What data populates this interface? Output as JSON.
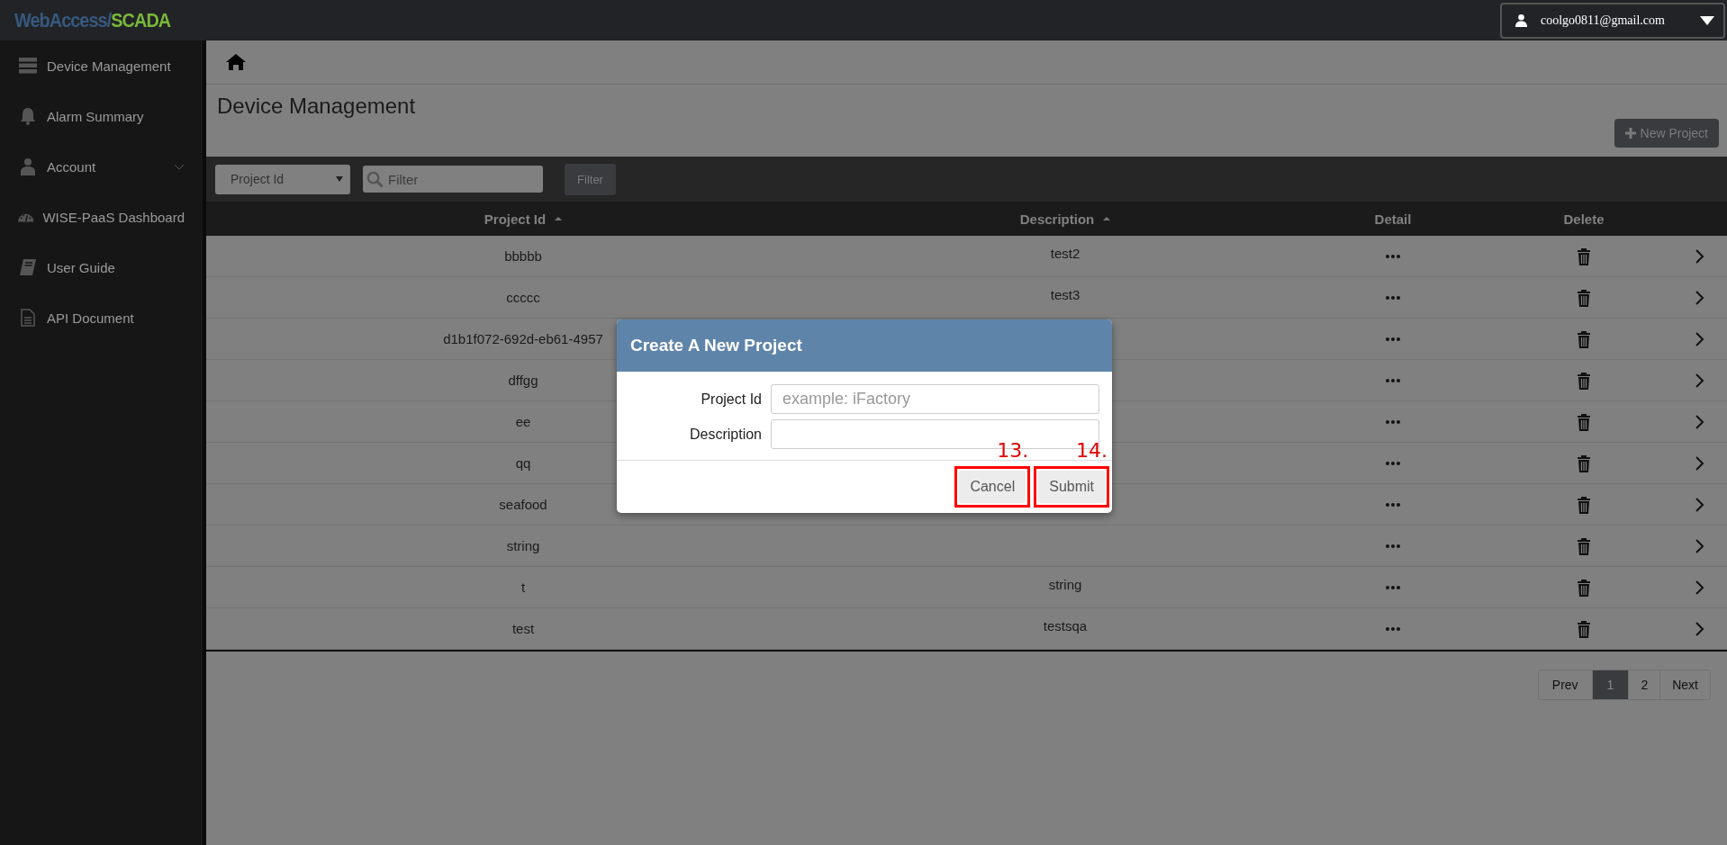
{
  "header": {
    "logo_primary": "WebAccess/",
    "logo_accent": "SCADA",
    "user": "coolgo0811@gmail.com"
  },
  "sidebar": {
    "items": [
      {
        "label": "Device Management",
        "kind": "server",
        "expandable": false
      },
      {
        "label": "Alarm Summary",
        "kind": "bell",
        "expandable": false
      },
      {
        "label": "Account",
        "kind": "user",
        "expandable": true
      },
      {
        "label": "WISE-PaaS Dashboard",
        "kind": "gauge",
        "expandable": false
      },
      {
        "label": "User Guide",
        "kind": "book",
        "expandable": false
      },
      {
        "label": "API Document",
        "kind": "document",
        "expandable": false
      }
    ]
  },
  "page": {
    "title": "Device Management",
    "new_button": "New Project"
  },
  "filter": {
    "field": "Project Id",
    "placeholder": "Filter",
    "button": "Filter"
  },
  "table": {
    "columns": [
      {
        "label": "Project Id",
        "sortable": true
      },
      {
        "label": "Description",
        "sortable": true
      },
      {
        "label": "Detail",
        "sortable": false
      },
      {
        "label": "Delete",
        "sortable": false
      }
    ],
    "rows": [
      {
        "project_id": "bbbbb",
        "description": "test2"
      },
      {
        "project_id": "ccccc",
        "description": "test3"
      },
      {
        "project_id": "d1b1f072-692d-eb61-4957"
      },
      {
        "project_id": "dffgg"
      },
      {
        "project_id": "ee"
      },
      {
        "project_id": "qq"
      },
      {
        "project_id": "seafood"
      },
      {
        "project_id": "string"
      },
      {
        "project_id": "t",
        "description": "string"
      },
      {
        "project_id": "test",
        "description": "testsqa"
      }
    ]
  },
  "pagination": {
    "prev": "Prev",
    "next": "Next",
    "pages": [
      {
        "label": "1",
        "selected": true
      },
      {
        "label": "2",
        "selected": false
      }
    ]
  },
  "dialog": {
    "title": "Create A New Project",
    "fields": [
      {
        "label": "Project Id",
        "placeholder": "example: iFactory"
      },
      {
        "label": "Description"
      }
    ],
    "buttons": [
      {
        "label": "Cancel",
        "marker": "13."
      },
      {
        "label": "Submit",
        "marker": "14."
      }
    ]
  }
}
